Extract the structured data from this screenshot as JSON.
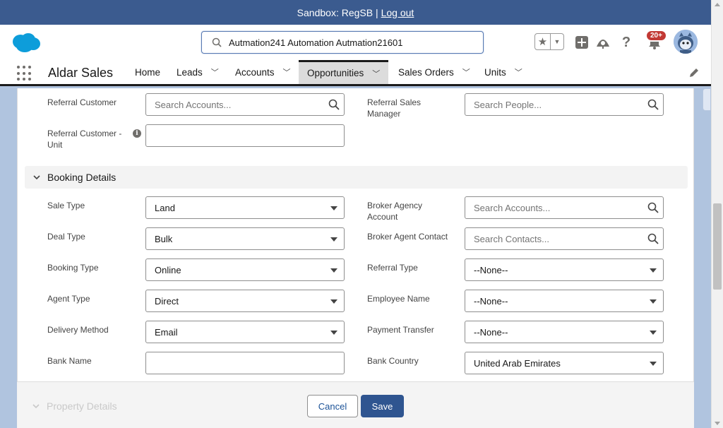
{
  "sandbox": {
    "text": "Sandbox: RegSB |",
    "logout": "Log out"
  },
  "header": {
    "search_value": "Autmation241 Automation Autmation21601",
    "notification_count": "20+"
  },
  "nav": {
    "app_name": "Aldar Sales",
    "items": [
      {
        "label": "Home"
      },
      {
        "label": "Leads"
      },
      {
        "label": "Accounts"
      },
      {
        "label": "Opportunities"
      },
      {
        "label": "Sales Orders"
      },
      {
        "label": "Units"
      }
    ]
  },
  "referral": {
    "referral_customer_label": "Referral Customer",
    "referral_customer_placeholder": "Search Accounts...",
    "referral_sales_manager_label": "Referral Sales Manager",
    "referral_sales_manager_placeholder": "Search People...",
    "referral_customer_unit_label": "Referral Customer - Unit",
    "referral_customer_unit_value": ""
  },
  "booking": {
    "section_title": "Booking Details",
    "sale_type_label": "Sale Type",
    "sale_type_value": "Land",
    "deal_type_label": "Deal Type",
    "deal_type_value": "Bulk",
    "booking_type_label": "Booking Type",
    "booking_type_value": "Online",
    "agent_type_label": "Agent Type",
    "agent_type_value": "Direct",
    "delivery_method_label": "Delivery Method",
    "delivery_method_value": "Email",
    "bank_name_label": "Bank Name",
    "bank_name_value": "",
    "broker_agency_label": "Broker Agency Account",
    "broker_agency_placeholder": "Search Accounts...",
    "broker_agent_label": "Broker Agent Contact",
    "broker_agent_placeholder": "Search Contacts...",
    "referral_type_label": "Referral Type",
    "referral_type_value": "--None--",
    "employee_name_label": "Employee Name",
    "employee_name_value": "--None--",
    "payment_transfer_label": "Payment Transfer",
    "payment_transfer_value": "--None--",
    "bank_country_label": "Bank Country",
    "bank_country_value": "United Arab Emirates"
  },
  "footer": {
    "next_section": "Property Details",
    "cancel": "Cancel",
    "save": "Save"
  },
  "colors": {
    "sandbox_bar": "#3b5b8f",
    "save_button": "#2f5590",
    "page_background": "#b0c4df"
  }
}
